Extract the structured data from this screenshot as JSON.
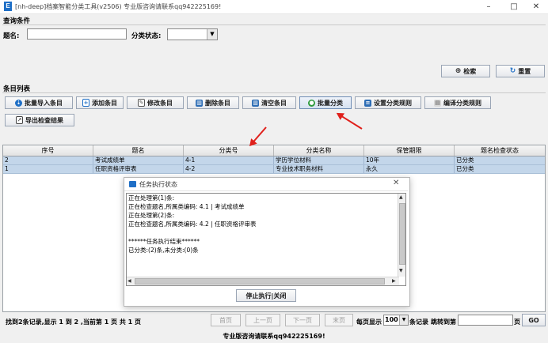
{
  "window": {
    "title": "[nh-deep]档案智能分类工具(v2506) 专业版咨询请联系qq942225169!",
    "app_icon_letter": "E"
  },
  "query": {
    "section_title": "查询条件",
    "title_label": "题名:",
    "title_value": "",
    "status_label": "分类状态:",
    "status_value": "",
    "search_button": "检索",
    "reset_button": "重置"
  },
  "list": {
    "section_title": "条目列表",
    "toolbar": {
      "bulk_import": "批量导入条目",
      "add": "添加条目",
      "edit": "修改条目",
      "delete": "删除条目",
      "clear": "清空条目",
      "bulk_classify": "批量分类",
      "set_rules": "设置分类规则",
      "compile_rules": "编译分类规则",
      "export_check": "导出检查结果"
    },
    "columns": [
      "序号",
      "题名",
      "分类号",
      "分类名称",
      "保管期限",
      "题名检查状态"
    ],
    "rows": [
      [
        "2",
        "考试成绩单",
        "4-1",
        "学历学位材料",
        "10年",
        "已分类"
      ],
      [
        "1",
        "任职资格评审表",
        "4-2",
        "专业技术职务材料",
        "永久",
        "已分类"
      ]
    ]
  },
  "dialog": {
    "title": "任务执行状态",
    "log_lines": [
      "正在处理第(1)条:",
      "正在检查题名,所属类编码: 4.1 | 考试成绩单",
      "正在处理第(2)条:",
      "正在检查题名,所属类编码: 4.2 | 任职资格评审表",
      "",
      "******任务执行结束******",
      "已分类:(2)条,未分类:(0)条"
    ],
    "stop_button": "停止执行|关闭"
  },
  "pager": {
    "summary": "找到2条记录,显示 1 到 2 ,当前第 1 页 共 1 页",
    "first": "首页",
    "prev": "上一页",
    "next": "下一页",
    "last": "末页",
    "per_page_label": "每页显示",
    "per_page_value": "100",
    "per_page_suffix": "条记录",
    "jump_label": "跳转到第",
    "jump_value": "",
    "page_suffix": "页",
    "go": "GO"
  },
  "footer": {
    "text": "专业版咨询请联系qq942225169!"
  },
  "colors": {
    "row_selected": "#c3d6ea",
    "arrow": "#e0201b",
    "accent": "#1f6fc6"
  }
}
